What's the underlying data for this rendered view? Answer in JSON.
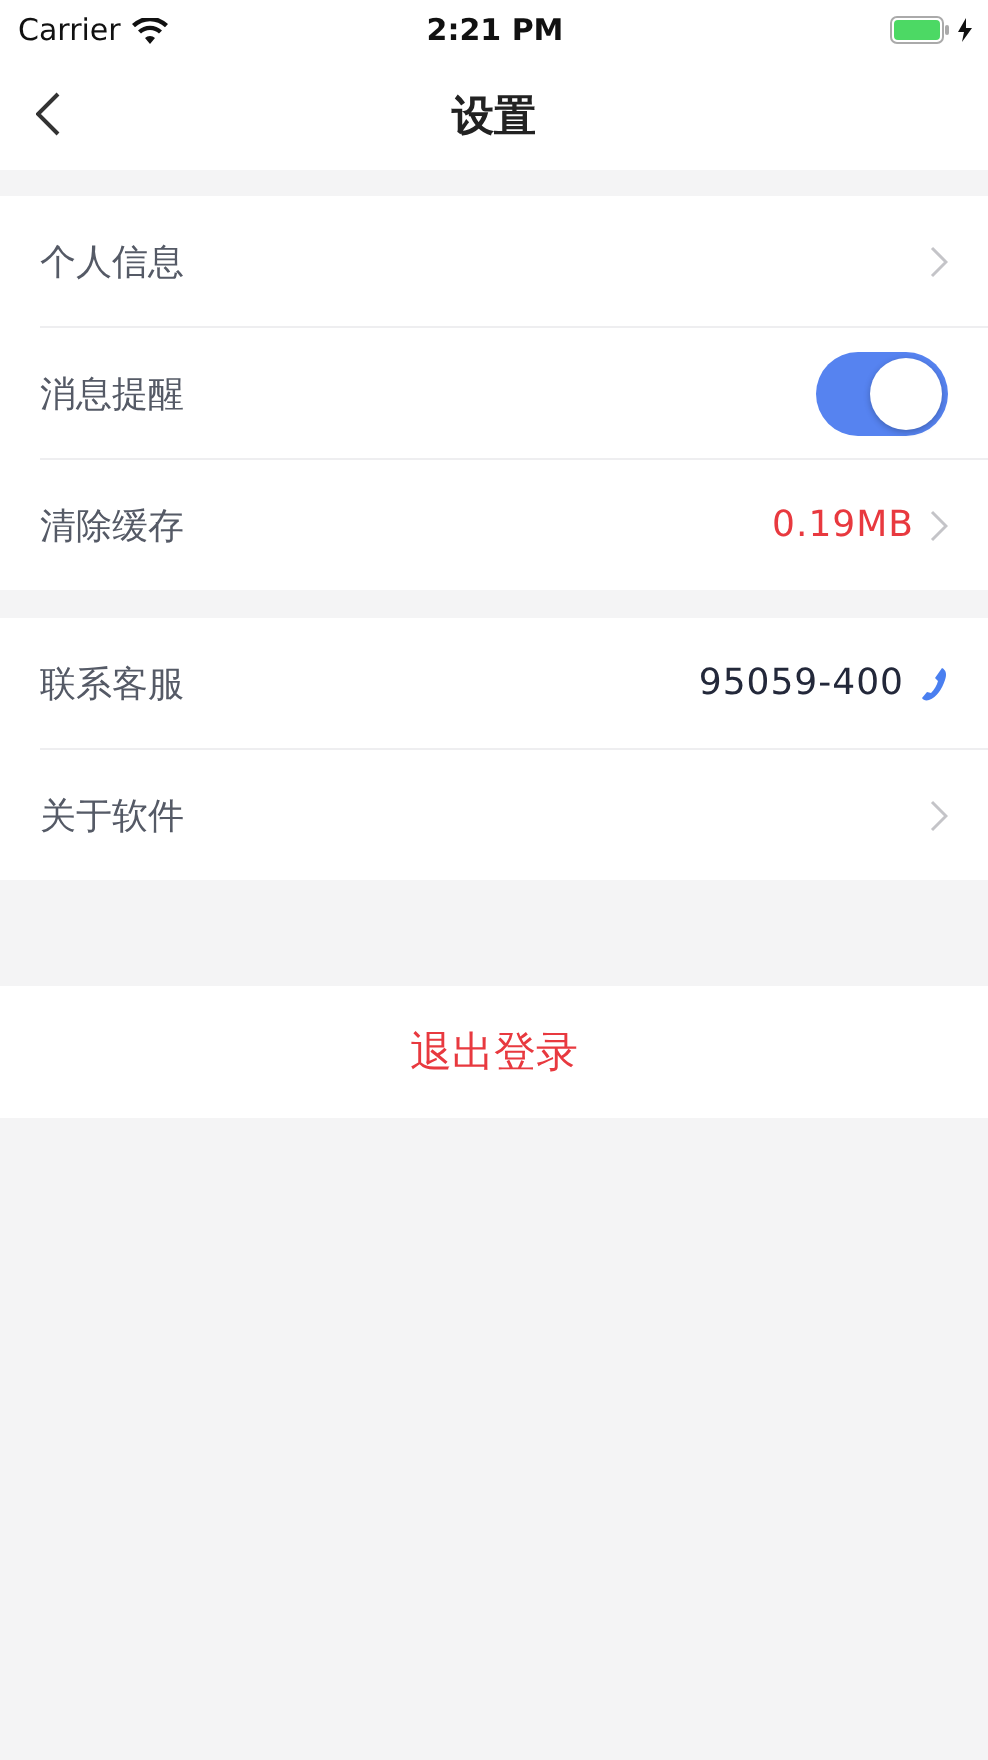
{
  "status_bar": {
    "carrier": "Carrier",
    "time": "2:21 PM"
  },
  "nav": {
    "title": "设置"
  },
  "groups": [
    {
      "rows": [
        {
          "kind": "link",
          "label": "个人信息"
        },
        {
          "kind": "switch",
          "label": "消息提醒",
          "on": true
        },
        {
          "kind": "value-link",
          "label": "清除缓存",
          "value": "0.19MB"
        }
      ]
    },
    {
      "rows": [
        {
          "kind": "phone",
          "label": "联系客服",
          "value": "95059-400"
        },
        {
          "kind": "link",
          "label": "关于软件"
        }
      ]
    }
  ],
  "logout": {
    "label": "退出登录"
  }
}
